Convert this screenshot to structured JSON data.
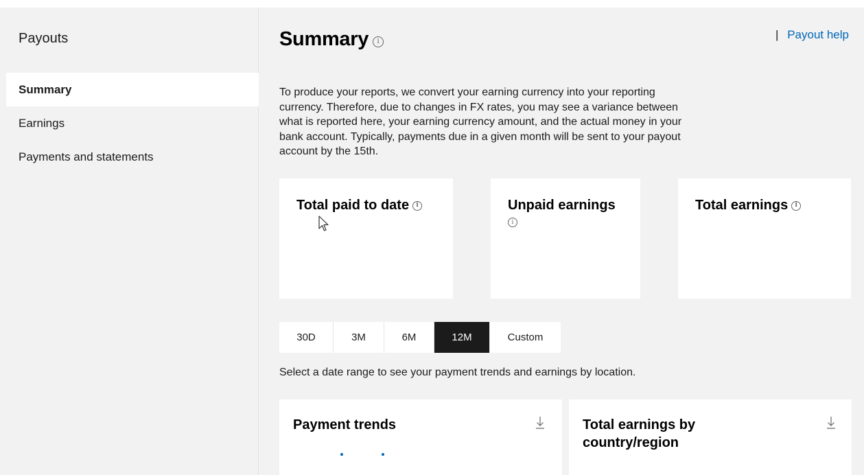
{
  "sidebar": {
    "title": "Payouts",
    "items": [
      {
        "label": "Summary",
        "active": true
      },
      {
        "label": "Earnings",
        "active": false
      },
      {
        "label": "Payments and statements",
        "active": false
      }
    ]
  },
  "main": {
    "title": "Summary",
    "help_separator": "|",
    "help_link": "Payout help",
    "description": "To produce your reports, we convert your earning currency into your reporting currency. Therefore, due to changes in FX rates, you may see a variance between what is reported here, your earning currency amount, and the actual money in your bank account. Typically, payments due in a given month will be sent to your payout account by the 15th.",
    "cards": {
      "total_paid": "Total paid to date",
      "unpaid": "Unpaid earnings",
      "total_earnings": "Total earnings"
    },
    "date_range": {
      "options": [
        "30D",
        "3M",
        "6M",
        "12M",
        "Custom"
      ],
      "selected": "12M",
      "hint": "Select a date range to see your payment trends and earnings by location."
    },
    "panels": {
      "payment_trends": "Payment trends",
      "earnings_by_country": "Total earnings by country/region"
    }
  },
  "icons": {
    "info": "info-icon",
    "download": "download-icon",
    "cursor": "mouse-cursor-icon"
  },
  "colors": {
    "accent": "#0067b8",
    "selected_bg": "#1b1b1b",
    "page_bg": "#f2f2f2"
  }
}
